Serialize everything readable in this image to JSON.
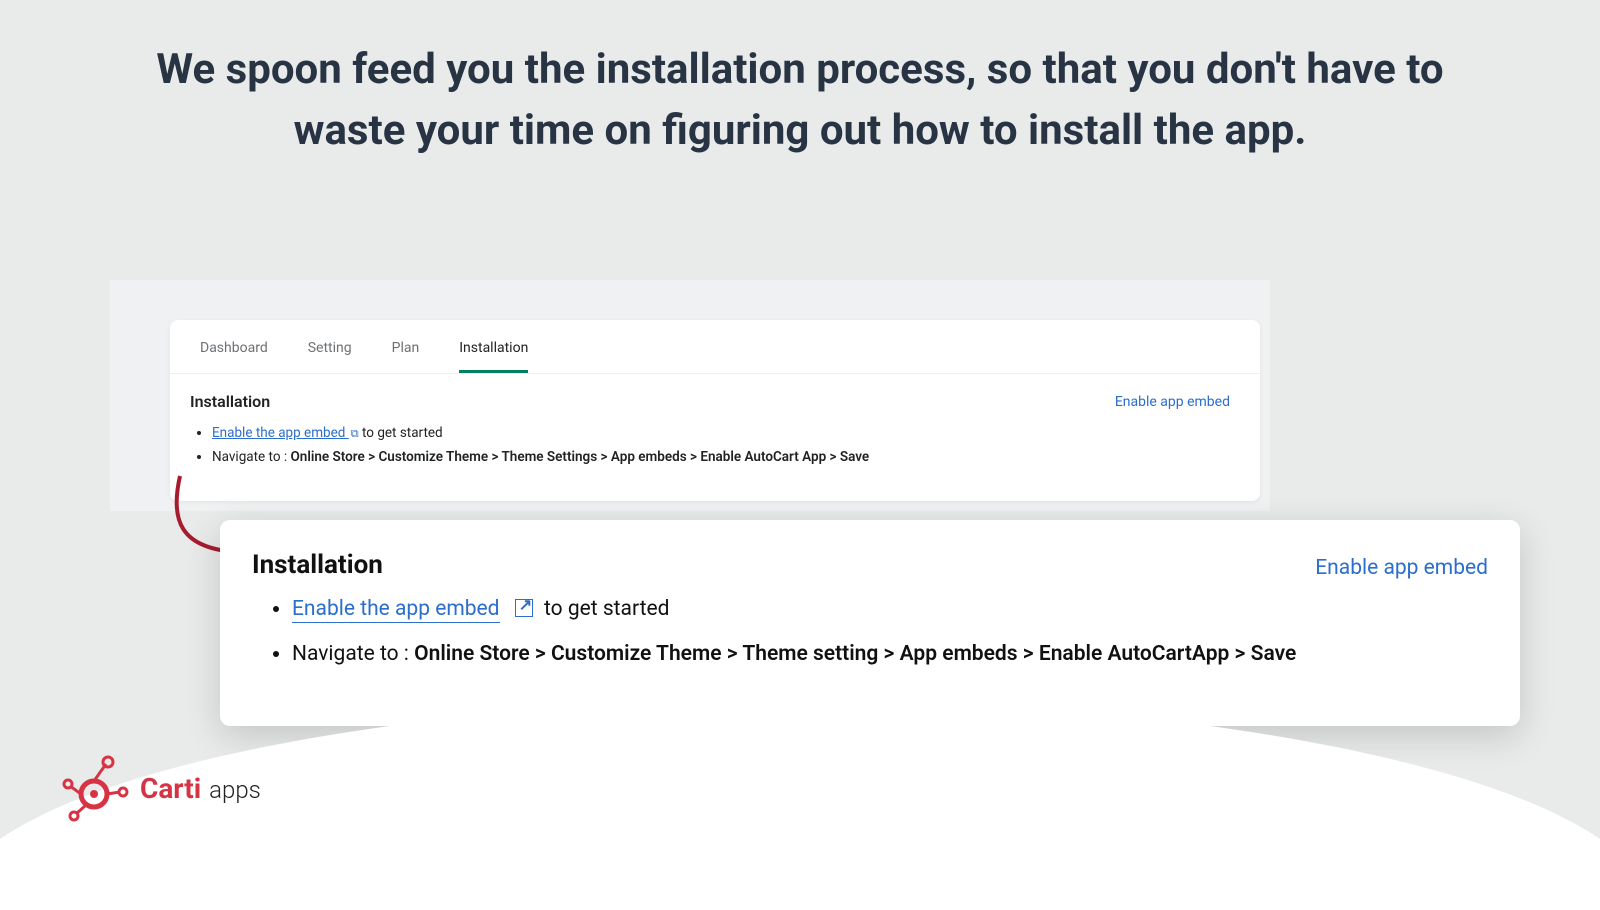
{
  "headline": "We spoon feed you the installation process, so that you don't have to waste your time on figuring out how to install the app.",
  "smallCard": {
    "tabs": [
      "Dashboard",
      "Setting",
      "Plan",
      "Installation"
    ],
    "activeTabIndex": 3,
    "heading": "Installation",
    "enableLabel": "Enable app embed",
    "bullet1_link": "Enable the app embed ",
    "bullet1_suffix": " to get started",
    "bullet2_prefix": "Navigate to : ",
    "bullet2_path": "Online Store > Customize Theme > Theme Settings > App embeds > Enable AutoCart App > Save"
  },
  "largeCard": {
    "heading": "Installation",
    "enableLabel": "Enable app embed",
    "bullet1_link": "Enable the app embed",
    "bullet1_suffix": " to get started",
    "bullet2_prefix": "Navigate to : ",
    "bullet2_path": "Online Store > Customize Theme > Theme setting > App embeds > Enable AutoCartApp > Save"
  },
  "logo": {
    "brand": "Carti",
    "sub": "apps"
  },
  "colors": {
    "accent": "#008060",
    "link": "#2c6ecb",
    "brand": "#d63444"
  }
}
